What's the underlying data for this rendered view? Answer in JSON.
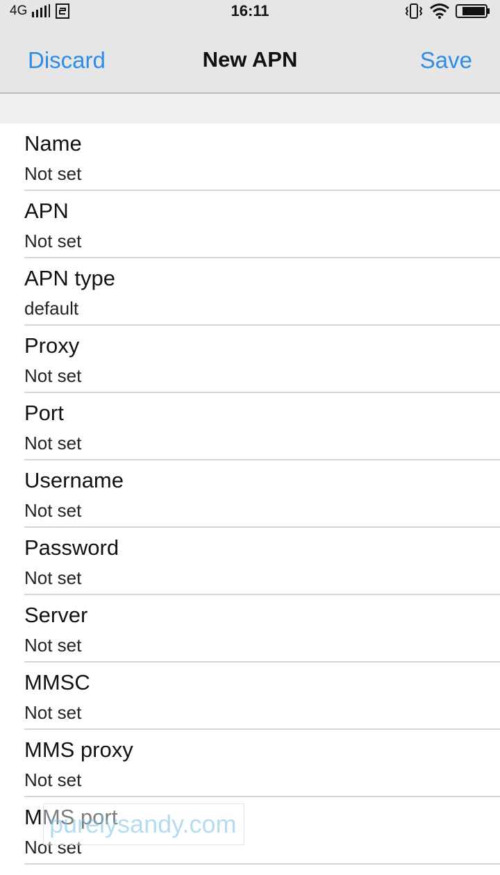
{
  "status_bar": {
    "network": "4G",
    "time": "16:11",
    "icons": [
      "signal-icon",
      "sim-icon",
      "vibrate-icon",
      "wifi-icon",
      "battery-icon"
    ]
  },
  "toolbar": {
    "discard_label": "Discard",
    "title": "New APN",
    "save_label": "Save"
  },
  "fields": [
    {
      "label": "Name",
      "value": "Not set"
    },
    {
      "label": "APN",
      "value": "Not set"
    },
    {
      "label": "APN type",
      "value": "default"
    },
    {
      "label": "Proxy",
      "value": "Not set"
    },
    {
      "label": "Port",
      "value": "Not set"
    },
    {
      "label": "Username",
      "value": "Not set"
    },
    {
      "label": "Password",
      "value": "Not set"
    },
    {
      "label": "Server",
      "value": "Not set"
    },
    {
      "label": "MMSC",
      "value": "Not set"
    },
    {
      "label": "MMS proxy",
      "value": "Not set"
    },
    {
      "label": "MMS port",
      "value": "Not set"
    }
  ],
  "watermark": "purelysandy.com",
  "colors": {
    "accent": "#2e8ce6",
    "toolbar_bg": "#e6e6e6"
  }
}
